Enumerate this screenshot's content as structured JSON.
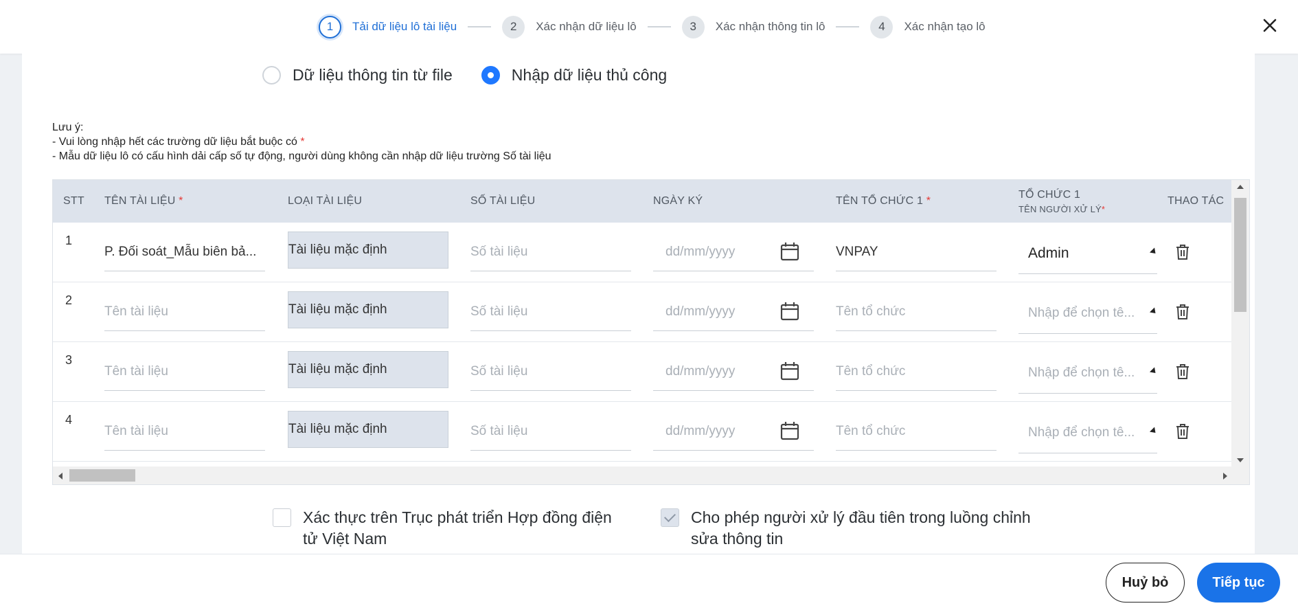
{
  "stepper": {
    "steps": [
      {
        "num": "1",
        "label": "Tải dữ liệu lô tài liệu"
      },
      {
        "num": "2",
        "label": "Xác nhận dữ liệu lô"
      },
      {
        "num": "3",
        "label": "Xác nhận thông tin lô"
      },
      {
        "num": "4",
        "label": "Xác nhận tạo lô"
      }
    ],
    "active_step": 1,
    "close_icon": "close-icon"
  },
  "source": {
    "option_file": "Dữ liệu thông tin từ file",
    "option_manual": "Nhập dữ liệu thủ công",
    "selected": "manual"
  },
  "notes": {
    "title": "Lưu ý:",
    "line1": "- Vui lòng nhập hết các trường dữ liệu bắt buộc có ",
    "line1_mark": "*",
    "line2": "- Mẫu dữ liệu lô có cấu hình dải cấp số tự động, người dùng không cần nhập dữ liệu trường Số tài liệu"
  },
  "table": {
    "headers": {
      "stt": "STT",
      "ten_tai_lieu": "TÊN TÀI LIỆU",
      "loai_tai_lieu": "LOẠI TÀI LIỆU",
      "so_tai_lieu": "SỐ TÀI LIỆU",
      "ngay_ky": "NGÀY KÝ",
      "ten_to_chuc": "TÊN TỔ CHỨC 1",
      "to_chuc": "TỔ CHỨC 1",
      "ten_nguoi_xu_ly": "TÊN NGƯỜI XỬ LÝ",
      "thao_tac": "THAO TÁC",
      "required_mark": "*"
    },
    "rows": [
      {
        "stt": "1",
        "ten_tai_lieu": "P. Đối soát_Mẫu biên bả...",
        "ten_tai_lieu_filled": true,
        "loai_tai_lieu": "Tài liệu mặc định",
        "so_tai_lieu": "Số tài liệu",
        "ngay_ky": "dd/mm/yyyy",
        "ten_to_chuc": "VNPAY",
        "ten_to_chuc_filled": true,
        "nguoi_xu_ly": "Admin",
        "nguoi_xu_ly_filled": true
      },
      {
        "stt": "2",
        "ten_tai_lieu": "Tên tài liệu",
        "ten_tai_lieu_filled": false,
        "loai_tai_lieu": "Tài liệu mặc định",
        "so_tai_lieu": "Số tài liệu",
        "ngay_ky": "dd/mm/yyyy",
        "ten_to_chuc": "Tên tổ chức",
        "ten_to_chuc_filled": false,
        "nguoi_xu_ly": "Nhập để chọn tê...",
        "nguoi_xu_ly_filled": false
      },
      {
        "stt": "3",
        "ten_tai_lieu": "Tên tài liệu",
        "ten_tai_lieu_filled": false,
        "loai_tai_lieu": "Tài liệu mặc định",
        "so_tai_lieu": "Số tài liệu",
        "ngay_ky": "dd/mm/yyyy",
        "ten_to_chuc": "Tên tổ chức",
        "ten_to_chuc_filled": false,
        "nguoi_xu_ly": "Nhập để chọn tê...",
        "nguoi_xu_ly_filled": false
      },
      {
        "stt": "4",
        "ten_tai_lieu": "Tên tài liệu",
        "ten_tai_lieu_filled": false,
        "loai_tai_lieu": "Tài liệu mặc định",
        "so_tai_lieu": "Số tài liệu",
        "ngay_ky": "dd/mm/yyyy",
        "ten_to_chuc": "Tên tổ chức",
        "ten_to_chuc_filled": false,
        "nguoi_xu_ly": "Nhập để chọn tê...",
        "nguoi_xu_ly_filled": false
      }
    ]
  },
  "options": {
    "verify_label": "Xác thực trên Trục phát triển Hợp đồng điện tử Việt Nam",
    "verify_checked": false,
    "allow_edit_label": "Cho phép người xử lý đầu tiên trong luồng chỉnh sửa thông tin",
    "allow_edit_checked": true
  },
  "footer": {
    "cancel_label": "Huỷ bỏ",
    "next_label": "Tiếp tục"
  },
  "colors": {
    "accent": "#1a73e8",
    "required": "#e53935",
    "header_bg": "#dde3ec"
  }
}
